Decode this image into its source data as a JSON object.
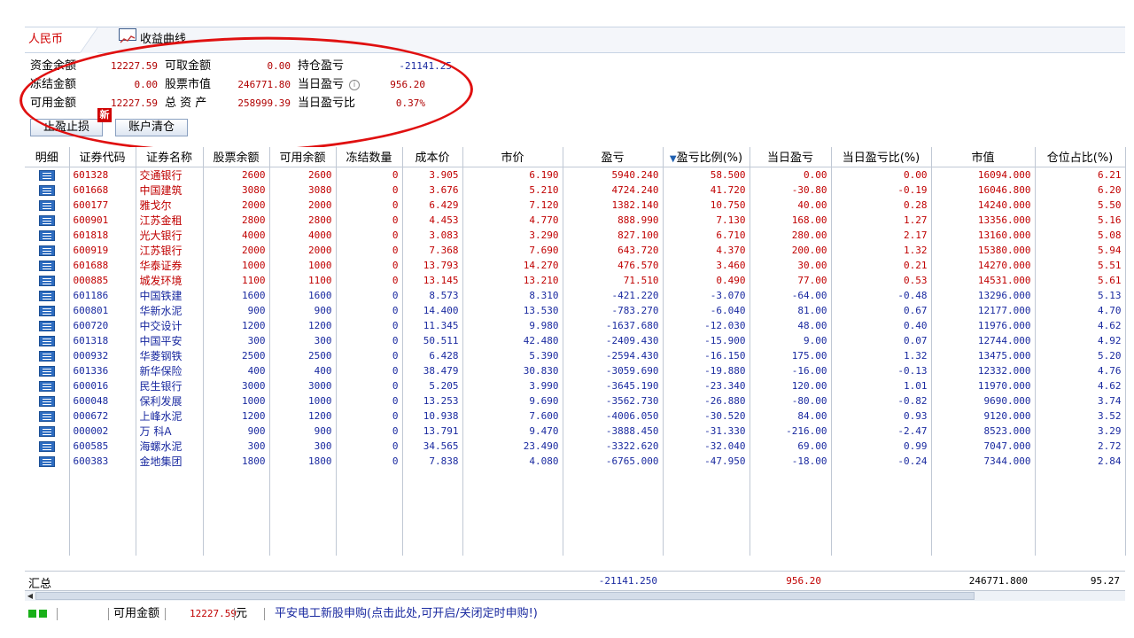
{
  "tabs": {
    "rmb": "人民币",
    "curve": "收益曲线"
  },
  "summary": {
    "fund_balance_label": "资金余额",
    "fund_balance": "12227.59",
    "withdrawable_label": "可取金额",
    "withdrawable": "0.00",
    "holding_pl_label": "持仓盈亏",
    "holding_pl": "-21141.25",
    "frozen_label": "冻结金额",
    "frozen": "0.00",
    "stock_value_label": "股票市值",
    "stock_value": "246771.80",
    "today_pl_label": "当日盈亏",
    "today_pl": "956.20",
    "available_label": "可用金额",
    "available": "12227.59",
    "total_assets_label": "总 资 产",
    "total_assets": "258999.39",
    "today_pl_ratio_label": "当日盈亏比",
    "today_pl_ratio": "0.37%"
  },
  "buttons": {
    "stop": "止盈止损",
    "new_badge": "新",
    "clear": "账户清仓"
  },
  "columns": [
    "明细",
    "证券代码",
    "证券名称",
    "股票余额",
    "可用余额",
    "冻结数量",
    "成本价",
    "市价",
    "盈亏",
    "盈亏比例(%)",
    "当日盈亏",
    "当日盈亏比(%)",
    "市值",
    "仓位占比(%)"
  ],
  "rows": [
    {
      "code": "601328",
      "name": "交通银行",
      "bal": "2600",
      "avail": "2600",
      "frozen": "0",
      "cost": "3.905",
      "price": "6.190",
      "pl": "5940.240",
      "pl_pct": "58.500",
      "tpl": "0.00",
      "tpl_pct": "0.00",
      "mv": "16094.000",
      "pos": "6.21",
      "color": "red"
    },
    {
      "code": "601668",
      "name": "中国建筑",
      "bal": "3080",
      "avail": "3080",
      "frozen": "0",
      "cost": "3.676",
      "price": "5.210",
      "pl": "4724.240",
      "pl_pct": "41.720",
      "tpl": "-30.80",
      "tpl_pct": "-0.19",
      "mv": "16046.800",
      "pos": "6.20",
      "color": "red"
    },
    {
      "code": "600177",
      "name": "雅戈尔",
      "bal": "2000",
      "avail": "2000",
      "frozen": "0",
      "cost": "6.429",
      "price": "7.120",
      "pl": "1382.140",
      "pl_pct": "10.750",
      "tpl": "40.00",
      "tpl_pct": "0.28",
      "mv": "14240.000",
      "pos": "5.50",
      "color": "red"
    },
    {
      "code": "600901",
      "name": "江苏金租",
      "bal": "2800",
      "avail": "2800",
      "frozen": "0",
      "cost": "4.453",
      "price": "4.770",
      "pl": "888.990",
      "pl_pct": "7.130",
      "tpl": "168.00",
      "tpl_pct": "1.27",
      "mv": "13356.000",
      "pos": "5.16",
      "color": "red"
    },
    {
      "code": "601818",
      "name": "光大银行",
      "bal": "4000",
      "avail": "4000",
      "frozen": "0",
      "cost": "3.083",
      "price": "3.290",
      "pl": "827.100",
      "pl_pct": "6.710",
      "tpl": "280.00",
      "tpl_pct": "2.17",
      "mv": "13160.000",
      "pos": "5.08",
      "color": "red"
    },
    {
      "code": "600919",
      "name": "江苏银行",
      "bal": "2000",
      "avail": "2000",
      "frozen": "0",
      "cost": "7.368",
      "price": "7.690",
      "pl": "643.720",
      "pl_pct": "4.370",
      "tpl": "200.00",
      "tpl_pct": "1.32",
      "mv": "15380.000",
      "pos": "5.94",
      "color": "red"
    },
    {
      "code": "601688",
      "name": "华泰证券",
      "bal": "1000",
      "avail": "1000",
      "frozen": "0",
      "cost": "13.793",
      "price": "14.270",
      "pl": "476.570",
      "pl_pct": "3.460",
      "tpl": "30.00",
      "tpl_pct": "0.21",
      "mv": "14270.000",
      "pos": "5.51",
      "color": "red"
    },
    {
      "code": "000885",
      "name": "城发环境",
      "bal": "1100",
      "avail": "1100",
      "frozen": "0",
      "cost": "13.145",
      "price": "13.210",
      "pl": "71.510",
      "pl_pct": "0.490",
      "tpl": "77.00",
      "tpl_pct": "0.53",
      "mv": "14531.000",
      "pos": "5.61",
      "color": "red"
    },
    {
      "code": "601186",
      "name": "中国铁建",
      "bal": "1600",
      "avail": "1600",
      "frozen": "0",
      "cost": "8.573",
      "price": "8.310",
      "pl": "-421.220",
      "pl_pct": "-3.070",
      "tpl": "-64.00",
      "tpl_pct": "-0.48",
      "mv": "13296.000",
      "pos": "5.13",
      "color": "blue"
    },
    {
      "code": "600801",
      "name": "华新水泥",
      "bal": "900",
      "avail": "900",
      "frozen": "0",
      "cost": "14.400",
      "price": "13.530",
      "pl": "-783.270",
      "pl_pct": "-6.040",
      "tpl": "81.00",
      "tpl_pct": "0.67",
      "mv": "12177.000",
      "pos": "4.70",
      "color": "blue"
    },
    {
      "code": "600720",
      "name": "中交设计",
      "bal": "1200",
      "avail": "1200",
      "frozen": "0",
      "cost": "11.345",
      "price": "9.980",
      "pl": "-1637.680",
      "pl_pct": "-12.030",
      "tpl": "48.00",
      "tpl_pct": "0.40",
      "mv": "11976.000",
      "pos": "4.62",
      "color": "blue"
    },
    {
      "code": "601318",
      "name": "中国平安",
      "bal": "300",
      "avail": "300",
      "frozen": "0",
      "cost": "50.511",
      "price": "42.480",
      "pl": "-2409.430",
      "pl_pct": "-15.900",
      "tpl": "9.00",
      "tpl_pct": "0.07",
      "mv": "12744.000",
      "pos": "4.92",
      "color": "blue"
    },
    {
      "code": "000932",
      "name": "华菱钢铁",
      "bal": "2500",
      "avail": "2500",
      "frozen": "0",
      "cost": "6.428",
      "price": "5.390",
      "pl": "-2594.430",
      "pl_pct": "-16.150",
      "tpl": "175.00",
      "tpl_pct": "1.32",
      "mv": "13475.000",
      "pos": "5.20",
      "color": "blue"
    },
    {
      "code": "601336",
      "name": "新华保险",
      "bal": "400",
      "avail": "400",
      "frozen": "0",
      "cost": "38.479",
      "price": "30.830",
      "pl": "-3059.690",
      "pl_pct": "-19.880",
      "tpl": "-16.00",
      "tpl_pct": "-0.13",
      "mv": "12332.000",
      "pos": "4.76",
      "color": "blue"
    },
    {
      "code": "600016",
      "name": "民生银行",
      "bal": "3000",
      "avail": "3000",
      "frozen": "0",
      "cost": "5.205",
      "price": "3.990",
      "pl": "-3645.190",
      "pl_pct": "-23.340",
      "tpl": "120.00",
      "tpl_pct": "1.01",
      "mv": "11970.000",
      "pos": "4.62",
      "color": "blue"
    },
    {
      "code": "600048",
      "name": "保利发展",
      "bal": "1000",
      "avail": "1000",
      "frozen": "0",
      "cost": "13.253",
      "price": "9.690",
      "pl": "-3562.730",
      "pl_pct": "-26.880",
      "tpl": "-80.00",
      "tpl_pct": "-0.82",
      "mv": "9690.000",
      "pos": "3.74",
      "color": "blue"
    },
    {
      "code": "000672",
      "name": "上峰水泥",
      "bal": "1200",
      "avail": "1200",
      "frozen": "0",
      "cost": "10.938",
      "price": "7.600",
      "pl": "-4006.050",
      "pl_pct": "-30.520",
      "tpl": "84.00",
      "tpl_pct": "0.93",
      "mv": "9120.000",
      "pos": "3.52",
      "color": "blue"
    },
    {
      "code": "000002",
      "name": "万 科A",
      "bal": "900",
      "avail": "900",
      "frozen": "0",
      "cost": "13.791",
      "price": "9.470",
      "pl": "-3888.450",
      "pl_pct": "-31.330",
      "tpl": "-216.00",
      "tpl_pct": "-2.47",
      "mv": "8523.000",
      "pos": "3.29",
      "color": "blue"
    },
    {
      "code": "600585",
      "name": "海螺水泥",
      "bal": "300",
      "avail": "300",
      "frozen": "0",
      "cost": "34.565",
      "price": "23.490",
      "pl": "-3322.620",
      "pl_pct": "-32.040",
      "tpl": "69.00",
      "tpl_pct": "0.99",
      "mv": "7047.000",
      "pos": "2.72",
      "color": "blue"
    },
    {
      "code": "600383",
      "name": "金地集团",
      "bal": "1800",
      "avail": "1800",
      "frozen": "0",
      "cost": "7.838",
      "price": "4.080",
      "pl": "-6765.000",
      "pl_pct": "-47.950",
      "tpl": "-18.00",
      "tpl_pct": "-0.24",
      "mv": "7344.000",
      "pos": "2.84",
      "color": "blue"
    }
  ],
  "totals": {
    "label": "汇总",
    "pl": "-21141.250",
    "tpl": "956.20",
    "mv": "246771.800",
    "pos": "95.27"
  },
  "status": {
    "avail_label": "可用金额",
    "avail": "12227.59",
    "unit": "元",
    "message": "平安电工新股申购(点击此处,可开启/关闭定时申购!)"
  },
  "colors": {
    "gain": "#c00000",
    "loss": "#1a2aa0",
    "annotation": "#e01010"
  }
}
